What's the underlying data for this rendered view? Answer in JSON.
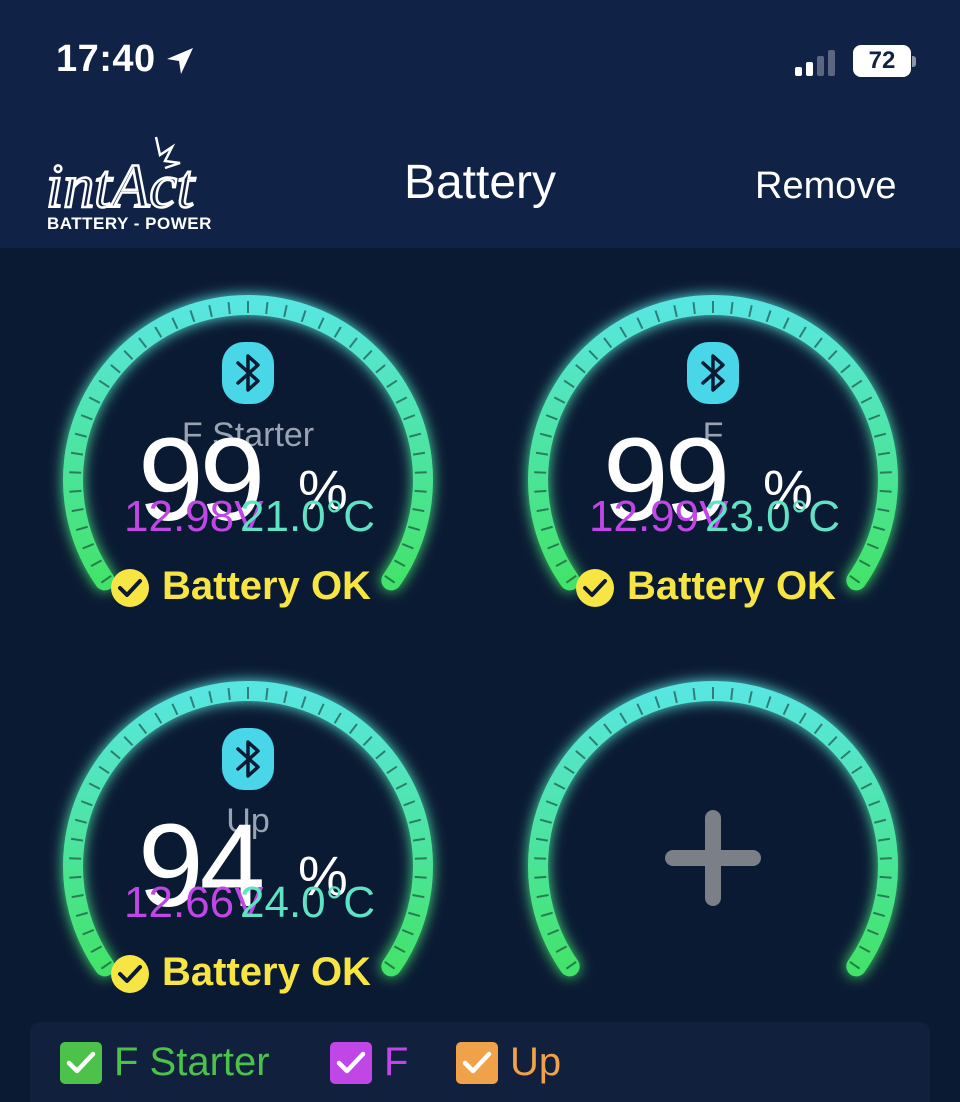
{
  "status_bar": {
    "time": "17:40",
    "battery_level": "72",
    "icons": [
      "location-arrow-icon",
      "signal-icon",
      "battery-icon"
    ]
  },
  "nav": {
    "logo_text": "intAct",
    "logo_subtitle": "BATTERY - POWER",
    "title": "Battery",
    "remove_label": "Remove"
  },
  "gauges": [
    {
      "name": "F Starter",
      "percent": "99",
      "percent_symbol": "%",
      "voltage": "12.98V",
      "temperature": "21.0°C",
      "status": "Battery OK",
      "connection": "bluetooth-icon"
    },
    {
      "name": "F",
      "percent": "99",
      "percent_symbol": "%",
      "voltage": "12.99V",
      "temperature": "23.0°C",
      "status": "Battery OK",
      "connection": "bluetooth-icon"
    },
    {
      "name": "Up",
      "percent": "94",
      "percent_symbol": "%",
      "voltage": "12.66V",
      "temperature": "24.0°C",
      "status": "Battery OK",
      "connection": "bluetooth-icon"
    }
  ],
  "add_gauge": {
    "icon": "plus-icon"
  },
  "legend": [
    {
      "label": "F Starter",
      "color": "#4cc24a",
      "checked": true
    },
    {
      "label": "F",
      "color": "#c046e6",
      "checked": true
    },
    {
      "label": "Up",
      "color": "#f0a24a",
      "checked": true
    }
  ],
  "colors": {
    "background": "#0b1a33",
    "header": "#102347",
    "gauge_green": "#3ff07a",
    "gauge_cyan": "#58e6e0",
    "status_yellow": "#f7e544",
    "voltage_purple": "#c046e6",
    "temperature_teal": "#5fe3c4"
  }
}
